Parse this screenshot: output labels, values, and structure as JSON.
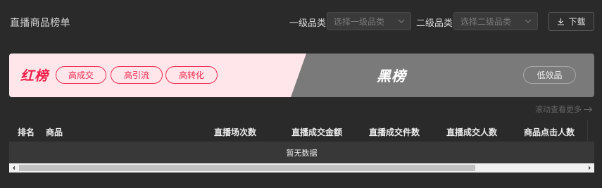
{
  "header": {
    "title": "直播商品榜单",
    "level1": {
      "label": "一级品类",
      "placeholder": "选择一级品类"
    },
    "level2": {
      "label": "二级品类",
      "placeholder": "选择二级品类"
    },
    "download_label": "下载"
  },
  "banner": {
    "red": {
      "title": "红榜",
      "tabs": [
        "高成交",
        "高引流",
        "高转化"
      ]
    },
    "black": {
      "title": "黑榜",
      "tabs": [
        "低效品"
      ]
    },
    "colors": {
      "red_bg": "#ffe6ea",
      "red_accent": "#ef1d47",
      "black_bg": "#7a7a7a"
    }
  },
  "scroll_hint": "滚动查看更多",
  "table": {
    "columns": [
      "排名",
      "商品",
      "直播场次数",
      "直播成交金额",
      "直播成交件数",
      "直播成交人数",
      "商品点击人数"
    ],
    "empty_text": "暂无数据"
  }
}
